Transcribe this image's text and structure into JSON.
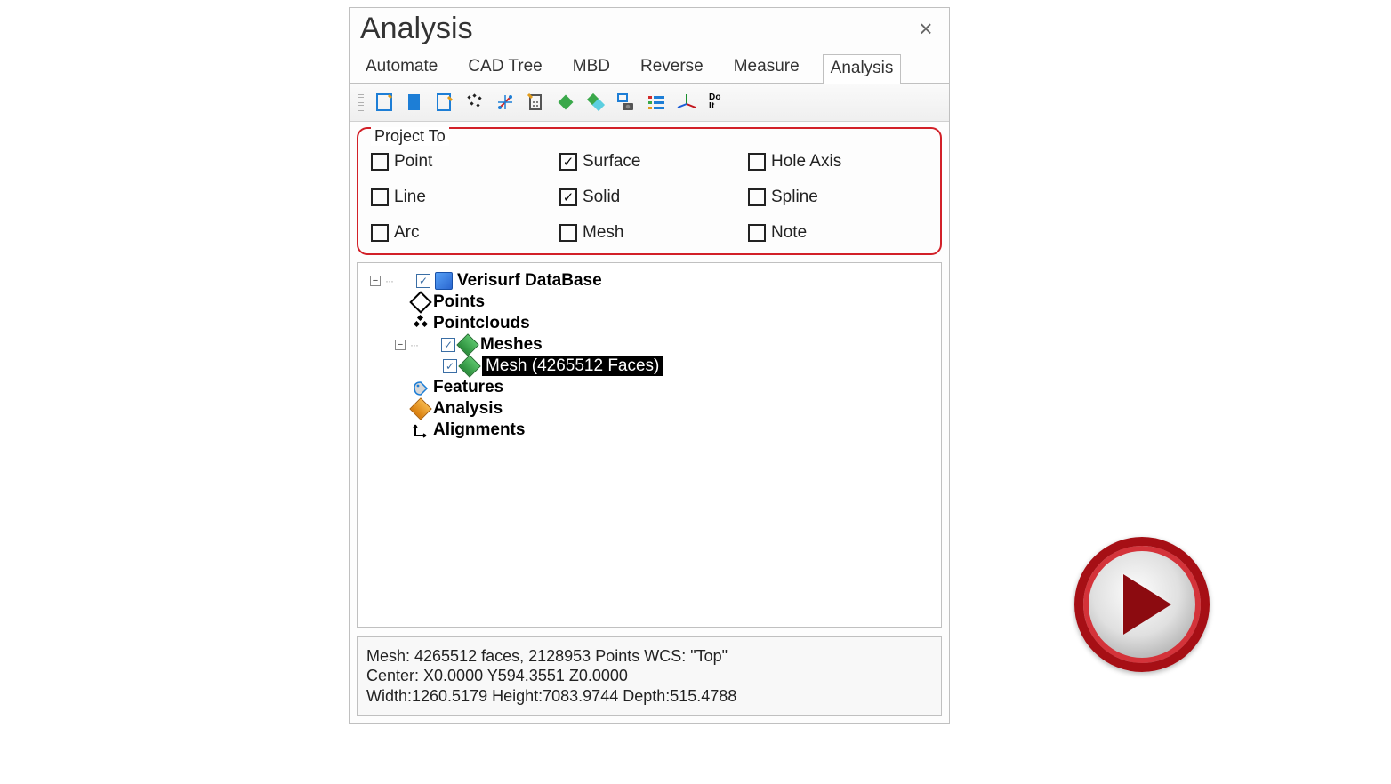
{
  "panel": {
    "title": "Analysis"
  },
  "tabs": {
    "automate": "Automate",
    "cadtree": "CAD Tree",
    "mbd": "MBD",
    "reverse": "Reverse",
    "measure": "Measure",
    "analysis": "Analysis"
  },
  "toolbar": {
    "doit": "Do\nIt"
  },
  "projectTo": {
    "label": "Project To",
    "point": {
      "label": "Point",
      "checked": false
    },
    "line": {
      "label": "Line",
      "checked": false
    },
    "arc": {
      "label": "Arc",
      "checked": false
    },
    "surface": {
      "label": "Surface",
      "checked": true
    },
    "solid": {
      "label": "Solid",
      "checked": true
    },
    "mesh": {
      "label": "Mesh",
      "checked": false
    },
    "holeaxis": {
      "label": "Hole Axis",
      "checked": false
    },
    "spline": {
      "label": "Spline",
      "checked": false
    },
    "note": {
      "label": "Note",
      "checked": false
    }
  },
  "tree": {
    "root": "Verisurf DataBase",
    "points": "Points",
    "pointclouds": "Pointclouds",
    "meshes": "Meshes",
    "mesh_item": "Mesh (4265512 Faces)",
    "features": "Features",
    "analysis": "Analysis",
    "alignments": "Alignments"
  },
  "info": {
    "line1": "Mesh: 4265512 faces, 2128953 Points  WCS: \"Top\"",
    "line2": "Center: X0.0000 Y594.3551 Z0.0000",
    "line3": "Width:1260.5179 Height:7083.9744 Depth:515.4788"
  }
}
